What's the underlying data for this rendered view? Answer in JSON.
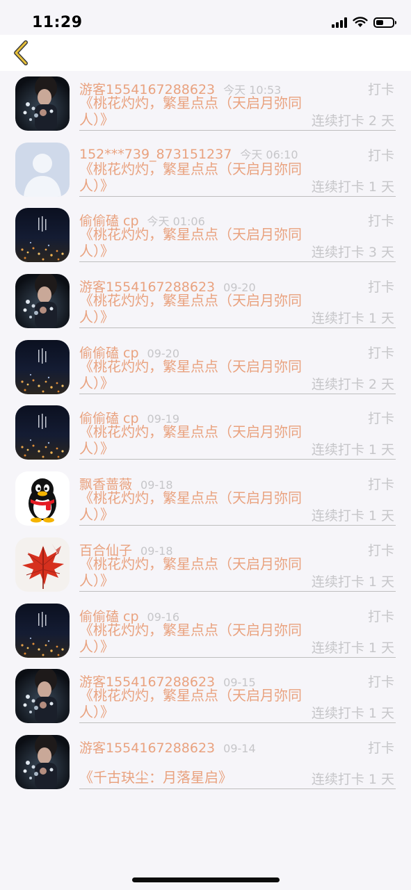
{
  "status_bar": {
    "time": "11:29"
  },
  "colors": {
    "accent": "#e9a27f",
    "muted": "#c6c6c9",
    "back_chevron": "#e7c03a"
  },
  "rows": [
    {
      "avatar": "woman-flowers-avatar",
      "name": "游客1554167288623",
      "time": "今天 10:53",
      "tag": "打卡",
      "book": "《桃花灼灼，繁星点点（天启月弥同人）》",
      "streak": "连续打卡 2 天"
    },
    {
      "avatar": "default-user-avatar",
      "name": "152***739_873151237",
      "time": "今天 06:10",
      "tag": "打卡",
      "book": "《桃花灼灼，繁星点点（天启月弥同人）》",
      "streak": "连续打卡 1 天"
    },
    {
      "avatar": "night-city-avatar",
      "name": "偷偷磕 cp",
      "time": "今天 01:06",
      "tag": "打卡",
      "book": "《桃花灼灼，繁星点点（天启月弥同人）》",
      "streak": "连续打卡 3 天"
    },
    {
      "avatar": "woman-flowers-avatar",
      "name": "游客1554167288623",
      "time": "09-20",
      "tag": "打卡",
      "book": "《桃花灼灼，繁星点点（天启月弥同人）》",
      "streak": "连续打卡 1 天"
    },
    {
      "avatar": "night-city-avatar",
      "name": "偷偷磕 cp",
      "time": "09-20",
      "tag": "打卡",
      "book": "《桃花灼灼，繁星点点（天启月弥同人）》",
      "streak": "连续打卡 2 天"
    },
    {
      "avatar": "night-city-avatar",
      "name": "偷偷磕 cp",
      "time": "09-19",
      "tag": "打卡",
      "book": "《桃花灼灼，繁星点点（天启月弥同人）》",
      "streak": "连续打卡 1 天"
    },
    {
      "avatar": "penguin-avatar",
      "name": "飘香蔷薇",
      "time": "09-18",
      "tag": "打卡",
      "book": "《桃花灼灼，繁星点点（天启月弥同人）》",
      "streak": "连续打卡 1 天"
    },
    {
      "avatar": "maple-leaf-avatar",
      "name": "百合仙子",
      "time": "09-18",
      "tag": "打卡",
      "book": "《桃花灼灼，繁星点点（天启月弥同人）》",
      "streak": "连续打卡 1 天"
    },
    {
      "avatar": "night-city-avatar",
      "name": "偷偷磕 cp",
      "time": "09-16",
      "tag": "打卡",
      "book": "《桃花灼灼，繁星点点（天启月弥同人）》",
      "streak": "连续打卡 1 天"
    },
    {
      "avatar": "woman-flowers-avatar",
      "name": "游客1554167288623",
      "time": "09-15",
      "tag": "打卡",
      "book": "《桃花灼灼，繁星点点（天启月弥同人）》",
      "streak": "连续打卡 1 天"
    },
    {
      "avatar": "woman-flowers-avatar",
      "name": "游客1554167288623",
      "time": "09-14",
      "tag": "打卡",
      "book": "《千古玦尘：月落星启》",
      "streak": "连续打卡 1 天",
      "single_line": true
    }
  ]
}
